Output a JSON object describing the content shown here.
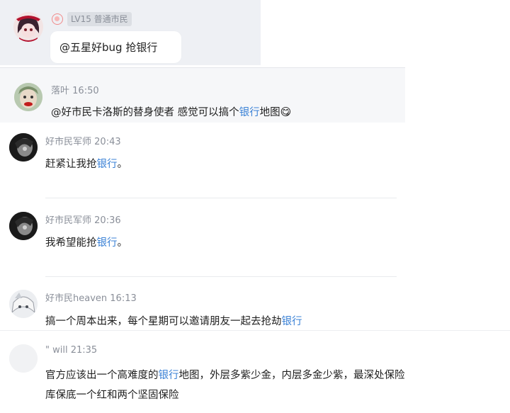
{
  "messages": [
    {
      "badge": "LV15 普通市民",
      "text": "@五星好bug 抢银行"
    },
    {
      "author": "落叶",
      "time": "16:50",
      "text_before": "@好市民卡洛斯的替身使者 感觉可以搞个",
      "link": "银行",
      "text_after": "地图",
      "emoji": "😋"
    },
    {
      "author": "好市民军师",
      "time": "20:43",
      "text_before": "赶紧让我抢",
      "link": "银行",
      "text_after": "。"
    },
    {
      "author": "好市民军师",
      "time": "20:36",
      "text_before": "我希望能抢",
      "link": "银行",
      "text_after": "。"
    },
    {
      "author": "好市民heaven",
      "time": "16:13",
      "text_before": "搞一个周本出来，每个星期可以邀请朋友一起去抢劫",
      "link": "银行"
    },
    {
      "author": "\" will",
      "time": "21:35",
      "line1_before": "官方应该出一个高难度的",
      "link": "银行",
      "line1_after": "地图，外层多紫少金，内层多金少紫，最深处保险",
      "line2": "库保底一个红和两个坚固保险"
    }
  ],
  "colors": {
    "link": "#3b82d6",
    "meta": "#8a8f99",
    "panel_top": "#eef0f4",
    "panel_mid": "#f6f7f9"
  }
}
